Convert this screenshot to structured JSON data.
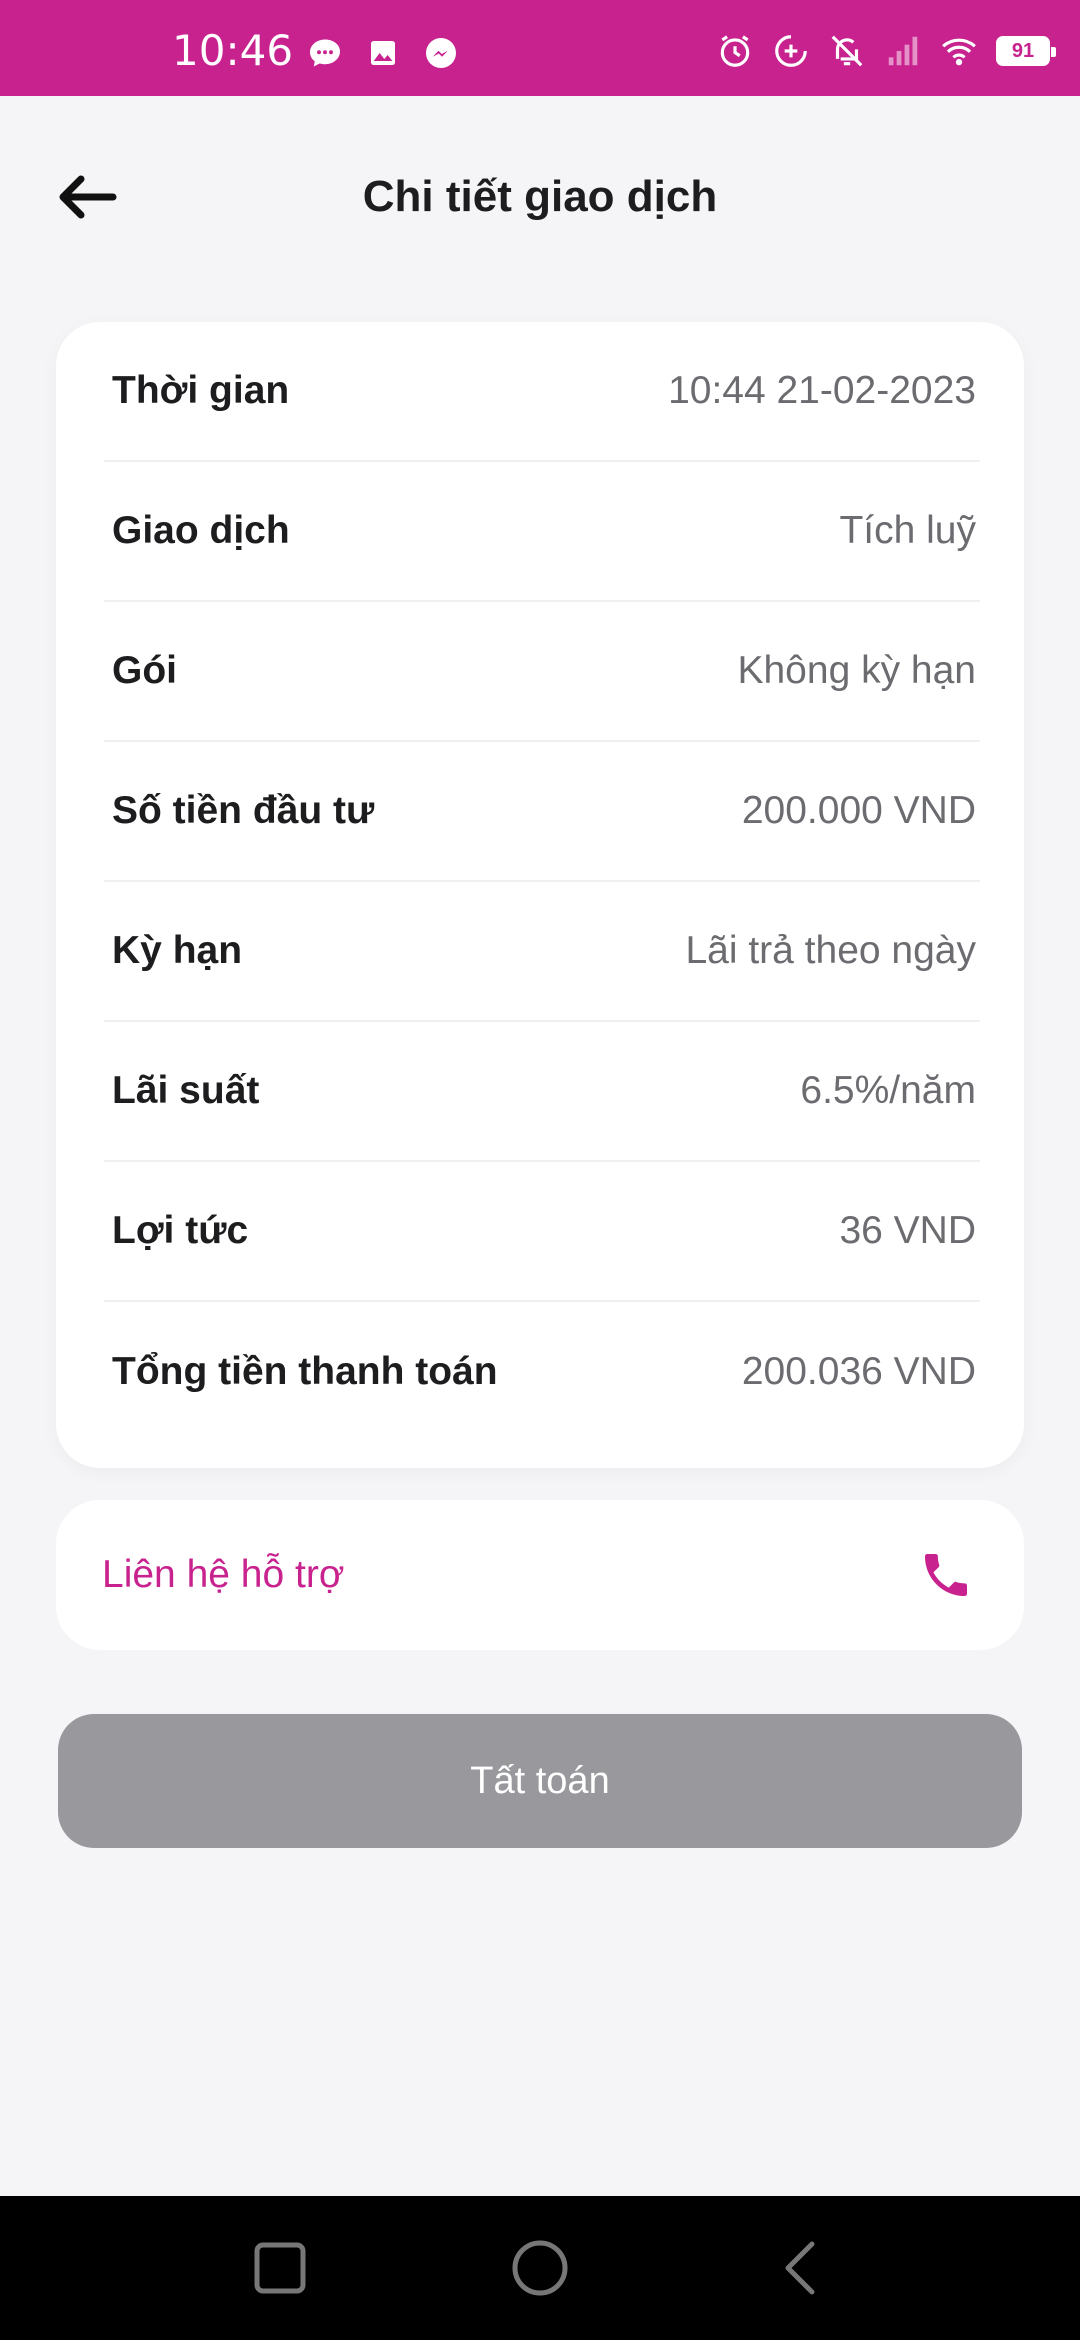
{
  "status_bar": {
    "time": "10:46",
    "battery": "91",
    "left_icons": [
      "message-icon",
      "image-icon",
      "messenger-icon"
    ],
    "right_icons": [
      "alarm-icon",
      "data-saver-icon",
      "bell-off-icon",
      "signal-icon",
      "wifi-icon",
      "battery-icon"
    ]
  },
  "header": {
    "title": "Chi tiết giao dịch",
    "back_icon": "arrow-left-icon"
  },
  "details": [
    {
      "label": "Thời gian",
      "value": "10:44 21-02-2023"
    },
    {
      "label": "Giao dịch",
      "value": "Tích luỹ"
    },
    {
      "label": "Gói",
      "value": "Không kỳ hạn"
    },
    {
      "label": "Số tiền đầu tư",
      "value": "200.000 VND"
    },
    {
      "label": "Kỳ hạn",
      "value": "Lãi trả theo ngày"
    },
    {
      "label": "Lãi suất",
      "value": "6.5%/năm"
    },
    {
      "label": "Lợi tức",
      "value": "36 VND"
    },
    {
      "label": "Tổng tiền thanh toán",
      "value": "200.036 VND"
    }
  ],
  "support": {
    "label": "Liên hệ hỗ trợ",
    "icon": "phone-icon"
  },
  "settle_button": {
    "label": "Tất toán"
  },
  "nav_bar": {
    "icons": [
      "recent-apps-icon",
      "home-icon",
      "back-icon"
    ]
  },
  "colors": {
    "brand": "#c8228f",
    "background": "#f5f5f7",
    "card": "#ffffff",
    "disabled_button": "#98989d",
    "label_text": "#1d1d1f",
    "value_text": "#6b6b70"
  }
}
